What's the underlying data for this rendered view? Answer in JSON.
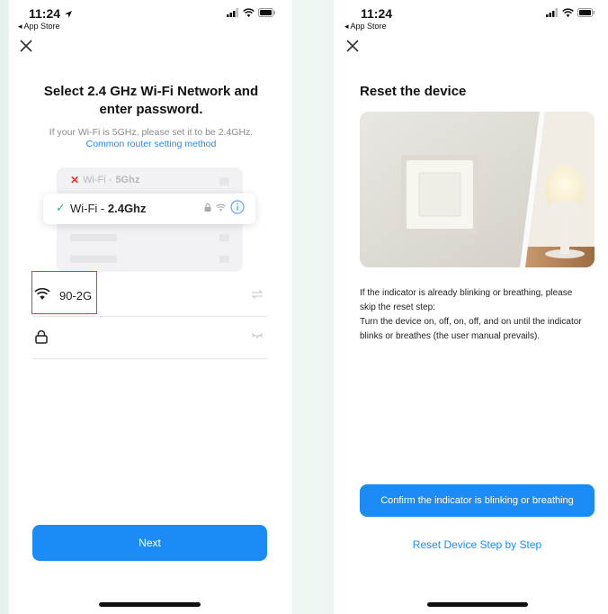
{
  "left": {
    "status": {
      "time": "11:24",
      "back": "◂ App Store"
    },
    "title": "Select 2.4 GHz Wi-Fi Network and enter password.",
    "hint": "If your Wi-Fi is 5GHz, please set it to be 2.4GHz.",
    "link": "Common router setting method",
    "band_5": {
      "prefix": "Wi-Fi - ",
      "band": "5Ghz"
    },
    "band_24": {
      "prefix": "Wi-Fi - ",
      "band": "2.4Ghz"
    },
    "ssid": "90-2G",
    "password": "",
    "next_button": "Next"
  },
  "right": {
    "status": {
      "time": "11:24",
      "back": "◂ App Store"
    },
    "title": "Reset the device",
    "desc_line1": "If the indicator is already blinking or breathing, please skip the reset step:",
    "desc_line2": "Turn the device on, off, on, off, and on until the indicator blinks or breathes (the user manual prevails).",
    "confirm_button": "Confirm the indicator is blinking or breathing",
    "reset_link": "Reset Device Step by Step"
  },
  "colors": {
    "accent": "#1d8bf5",
    "link": "#1a8cff",
    "success": "#2ab673",
    "error": "#e53935"
  }
}
